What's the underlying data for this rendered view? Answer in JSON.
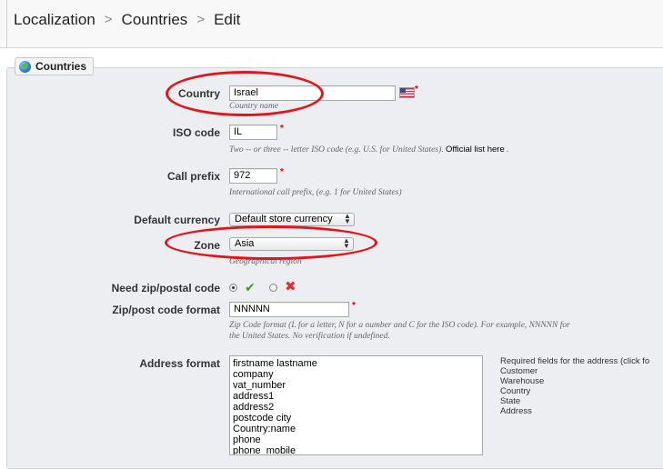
{
  "breadcrumb": {
    "items": [
      "Localization",
      "Countries",
      "Edit"
    ],
    "separator": ">"
  },
  "panel": {
    "legend": "Countries",
    "legend_icon": "globe-icon"
  },
  "fields": {
    "country": {
      "label": "Country",
      "value": "Israel",
      "hint": "Country name",
      "flag_icon": "us-flag-icon"
    },
    "iso_code": {
      "label": "ISO code",
      "value": "IL",
      "hint": "Two -- or three -- letter ISO code (e.g. U.S. for United States).",
      "hint_link": "Official list here",
      "hint_tail": "."
    },
    "call_prefix": {
      "label": "Call prefix",
      "value": "972",
      "hint": "International call prefix, (e.g. 1 for United States)"
    },
    "default_currency": {
      "label": "Default currency",
      "value": "Default store currency"
    },
    "zone": {
      "label": "Zone",
      "value": "Asia",
      "hint": "Geographical region"
    },
    "need_zip": {
      "label": "Need zip/postal code",
      "selected": "yes"
    },
    "zip_format": {
      "label": "Zip/post code format",
      "value": "NNNNN",
      "hint_line1": "Zip Code format (L for a letter, N for a number and C for the ISO code). For example, NNNNN for",
      "hint_line2": "the United States. No verification if undefined."
    },
    "address_format": {
      "label": "Address format",
      "lines": [
        "firstname lastname",
        "company",
        "vat_number",
        "address1",
        "address2",
        "postcode city",
        "Country:name",
        "phone",
        "phone_mobile"
      ],
      "side_title": "Required fields for the address (click fo",
      "side_items": [
        "Customer",
        "Warehouse",
        "Country",
        "State",
        "Address"
      ]
    }
  },
  "required_mark": "*",
  "colors": {
    "highlight": "#e0161d",
    "panel_bg": "#eceef1",
    "yes": "#3aa01d",
    "no": "#e03030"
  }
}
